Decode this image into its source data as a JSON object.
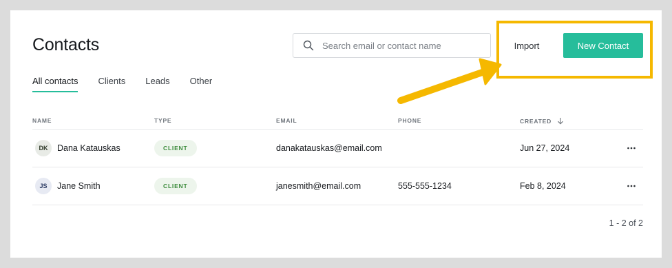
{
  "page": {
    "title": "Contacts"
  },
  "search": {
    "placeholder": "Search email or contact name",
    "value": "",
    "icon": "search-icon"
  },
  "toolbar": {
    "import_label": "Import",
    "new_contact_label": "New Contact",
    "accent_color": "#26bd9b",
    "highlight_color": "#f5b800"
  },
  "tabs": [
    {
      "label": "All contacts",
      "active": true
    },
    {
      "label": "Clients",
      "active": false
    },
    {
      "label": "Leads",
      "active": false
    },
    {
      "label": "Other",
      "active": false
    }
  ],
  "table": {
    "columns": {
      "name": "NAME",
      "type": "TYPE",
      "email": "EMAIL",
      "phone": "PHONE",
      "created": "CREATED"
    },
    "sort": {
      "column": "created",
      "direction": "descending"
    },
    "rows": [
      {
        "initials": "DK",
        "name": "Dana Katauskas",
        "type": "CLIENT",
        "email": "danakatauskas@email.com",
        "phone": "",
        "created": "Jun 27, 2024"
      },
      {
        "initials": "JS",
        "name": "Jane Smith",
        "type": "CLIENT",
        "email": "janesmith@email.com",
        "phone": "555-555-1234",
        "created": "Feb 8, 2024"
      }
    ]
  },
  "pagination": {
    "label": "1 - 2 of 2"
  }
}
